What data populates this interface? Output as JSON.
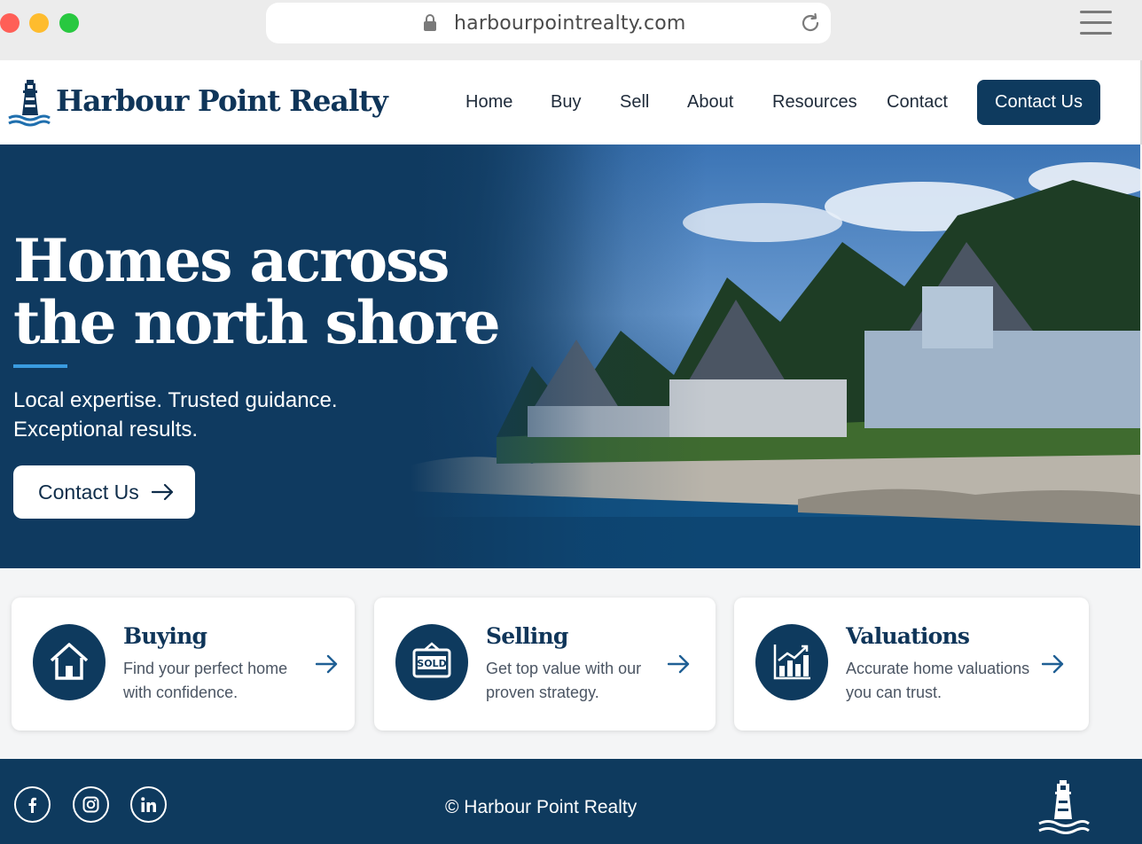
{
  "browser": {
    "url": "harbourpointrealty.com"
  },
  "header": {
    "brand": "Harbour Point Realty",
    "nav": [
      "Home",
      "Buy",
      "Sell",
      "About",
      "Resources",
      "Contact"
    ],
    "cta": "Contact Us"
  },
  "hero": {
    "title_lines": [
      "Homes across",
      "the north shore"
    ],
    "subtitle_lines": [
      "Local expertise. Trusted guidance.",
      "Exceptional results."
    ],
    "cta": "Contact Us"
  },
  "cards": [
    {
      "title": "Buying",
      "desc_lines": [
        "Find your perfect home",
        "with confidence."
      ],
      "icon": "house-icon"
    },
    {
      "title": "Selling",
      "desc_lines": [
        "Get top value with our",
        "proven strategy."
      ],
      "icon": "sold-sign-icon",
      "icon_text": "SOLD"
    },
    {
      "title": "Valuations",
      "desc_lines": [
        "Accurate home valuations",
        "you can trust."
      ],
      "icon": "growth-chart-icon"
    }
  ],
  "footer": {
    "social": [
      "facebook-icon",
      "instagram-icon",
      "linkedin-icon"
    ],
    "copyright": "© Harbour Point Realty"
  },
  "colors": {
    "navy": "#0e3a5e",
    "accent": "#3a9be0",
    "brand_text": "#0f3559"
  }
}
